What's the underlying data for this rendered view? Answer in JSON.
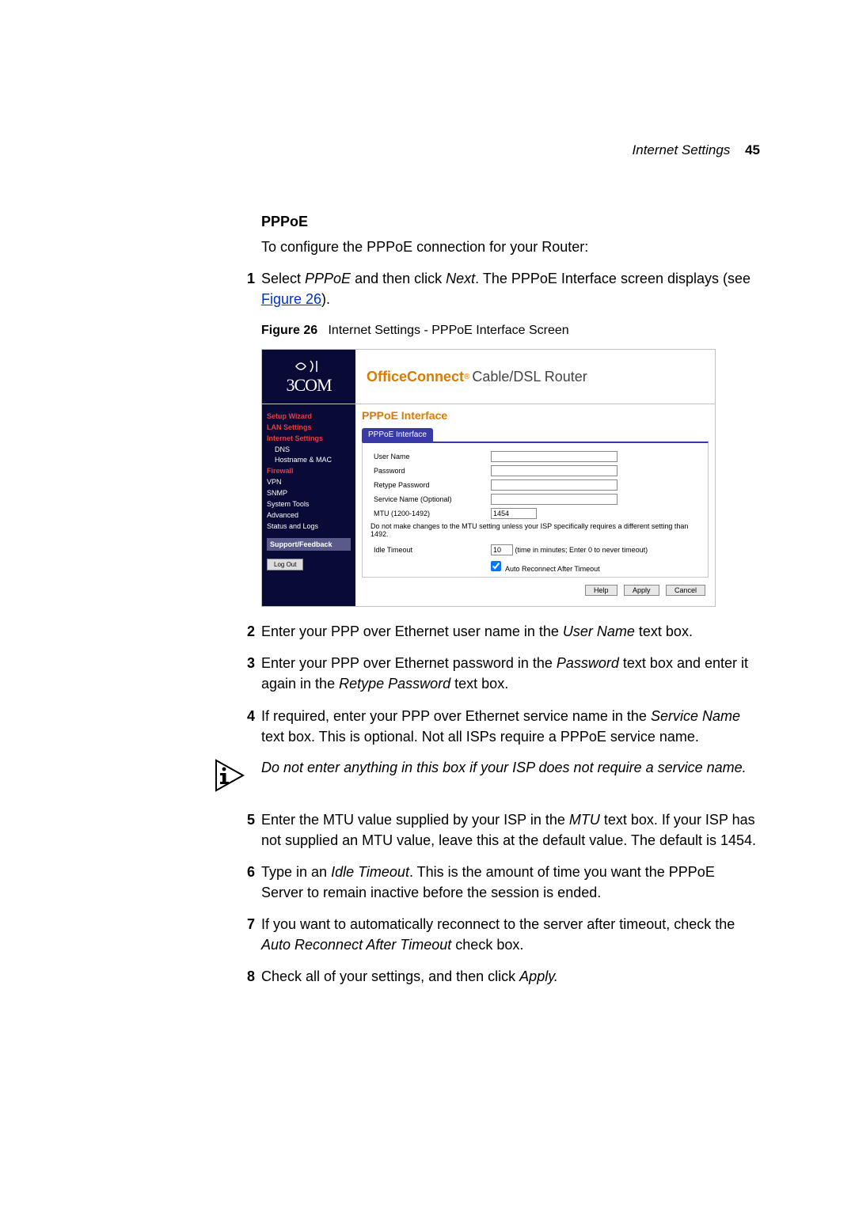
{
  "header": {
    "section": "Internet Settings",
    "page": "45"
  },
  "section_heading": "PPPoE",
  "intro": "To configure the PPPoE connection for your Router:",
  "step1": {
    "num": "1",
    "pre": "Select ",
    "em1": "PPPoE",
    "mid": " and then click ",
    "em2": "Next",
    "post": ". The PPPoE Interface screen displays (see ",
    "link": "Figure 26",
    "end": ")."
  },
  "figure": {
    "label": "Figure 26",
    "caption": "Internet Settings - PPPoE Interface Screen"
  },
  "screenshot": {
    "logo_text": "3COM",
    "product_brand": "OfficeConnect",
    "product_reg": "®",
    "product_desc": " Cable/DSL Router",
    "nav": {
      "setup": "Setup Wizard",
      "lan": "LAN Settings",
      "internet": "Internet Settings",
      "dns": "DNS",
      "hostmac": "Hostname & MAC",
      "firewall": "Firewall",
      "vpn": "VPN",
      "snmp": "SNMP",
      "tools": "System Tools",
      "advanced": "Advanced",
      "status": "Status and Logs",
      "support": "Support/Feedback",
      "logout": "Log Out"
    },
    "main_title": "PPPoE Interface",
    "tab": "PPPoE Interface",
    "form": {
      "username_label": "User Name",
      "password_label": "Password",
      "retype_label": "Retype Password",
      "service_label": "Service Name (Optional)",
      "mtu_label": "MTU (1200-1492)",
      "mtu_value": "1454",
      "mtu_note": "Do not make changes to the MTU setting unless your ISP specifically requires a different setting than 1492.",
      "idle_label": "Idle Timeout",
      "idle_value": "10",
      "idle_hint": "(time in minutes; Enter 0 to never timeout)",
      "auto_label": "Auto Reconnect After Timeout"
    },
    "buttons": {
      "help": "Help",
      "apply": "Apply",
      "cancel": "Cancel"
    }
  },
  "step2": {
    "num": "2",
    "pre": "Enter your PPP over Ethernet user name in the ",
    "em": "User Name",
    "post": " text box."
  },
  "step3": {
    "num": "3",
    "pre": "Enter your PPP over Ethernet password in the ",
    "em1": "Password",
    "mid": " text box and enter it again in the ",
    "em2": "Retype Password",
    "post": " text box."
  },
  "step4": {
    "num": "4",
    "pre": "If required, enter your PPP over Ethernet service name in the ",
    "em": "Service Name",
    "post": " text box. This is optional. Not all ISPs require a PPPoE service name."
  },
  "note": "Do not enter anything in this box if your ISP does not require a service name.",
  "step5": {
    "num": "5",
    "pre": "Enter the MTU value supplied by your ISP in the ",
    "em": "MTU",
    "post": " text box. If your ISP has not supplied an MTU value, leave this at the default value. The default is 1454."
  },
  "step6": {
    "num": "6",
    "pre": "Type in an ",
    "em": "Idle Timeout",
    "post": ". This is the amount of time you want the PPPoE Server to remain inactive before the session is ended."
  },
  "step7": {
    "num": "7",
    "pre": "If you want to automatically reconnect to the server after timeout, check the ",
    "em": "Auto Reconnect After Timeout",
    "post": " check box."
  },
  "step8": {
    "num": "8",
    "pre": "Check all of your settings, and then click ",
    "em": "Apply.",
    "post": ""
  }
}
